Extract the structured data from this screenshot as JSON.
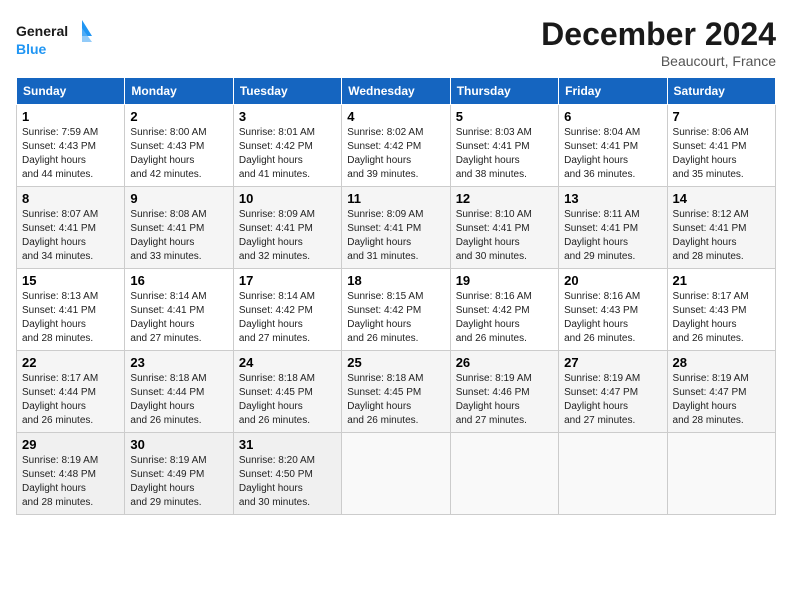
{
  "header": {
    "logo_line1": "General",
    "logo_line2": "Blue",
    "month": "December 2024",
    "location": "Beaucourt, France"
  },
  "weekdays": [
    "Sunday",
    "Monday",
    "Tuesday",
    "Wednesday",
    "Thursday",
    "Friday",
    "Saturday"
  ],
  "weeks": [
    [
      {
        "day": "1",
        "rise": "7:59 AM",
        "set": "4:43 PM",
        "daylight": "8 hours and 44 minutes."
      },
      {
        "day": "2",
        "rise": "8:00 AM",
        "set": "4:43 PM",
        "daylight": "8 hours and 42 minutes."
      },
      {
        "day": "3",
        "rise": "8:01 AM",
        "set": "4:42 PM",
        "daylight": "8 hours and 41 minutes."
      },
      {
        "day": "4",
        "rise": "8:02 AM",
        "set": "4:42 PM",
        "daylight": "8 hours and 39 minutes."
      },
      {
        "day": "5",
        "rise": "8:03 AM",
        "set": "4:41 PM",
        "daylight": "8 hours and 38 minutes."
      },
      {
        "day": "6",
        "rise": "8:04 AM",
        "set": "4:41 PM",
        "daylight": "8 hours and 36 minutes."
      },
      {
        "day": "7",
        "rise": "8:06 AM",
        "set": "4:41 PM",
        "daylight": "8 hours and 35 minutes."
      }
    ],
    [
      {
        "day": "8",
        "rise": "8:07 AM",
        "set": "4:41 PM",
        "daylight": "8 hours and 34 minutes."
      },
      {
        "day": "9",
        "rise": "8:08 AM",
        "set": "4:41 PM",
        "daylight": "8 hours and 33 minutes."
      },
      {
        "day": "10",
        "rise": "8:09 AM",
        "set": "4:41 PM",
        "daylight": "8 hours and 32 minutes."
      },
      {
        "day": "11",
        "rise": "8:09 AM",
        "set": "4:41 PM",
        "daylight": "8 hours and 31 minutes."
      },
      {
        "day": "12",
        "rise": "8:10 AM",
        "set": "4:41 PM",
        "daylight": "8 hours and 30 minutes."
      },
      {
        "day": "13",
        "rise": "8:11 AM",
        "set": "4:41 PM",
        "daylight": "8 hours and 29 minutes."
      },
      {
        "day": "14",
        "rise": "8:12 AM",
        "set": "4:41 PM",
        "daylight": "8 hours and 28 minutes."
      }
    ],
    [
      {
        "day": "15",
        "rise": "8:13 AM",
        "set": "4:41 PM",
        "daylight": "8 hours and 28 minutes."
      },
      {
        "day": "16",
        "rise": "8:14 AM",
        "set": "4:41 PM",
        "daylight": "8 hours and 27 minutes."
      },
      {
        "day": "17",
        "rise": "8:14 AM",
        "set": "4:42 PM",
        "daylight": "8 hours and 27 minutes."
      },
      {
        "day": "18",
        "rise": "8:15 AM",
        "set": "4:42 PM",
        "daylight": "8 hours and 26 minutes."
      },
      {
        "day": "19",
        "rise": "8:16 AM",
        "set": "4:42 PM",
        "daylight": "8 hours and 26 minutes."
      },
      {
        "day": "20",
        "rise": "8:16 AM",
        "set": "4:43 PM",
        "daylight": "8 hours and 26 minutes."
      },
      {
        "day": "21",
        "rise": "8:17 AM",
        "set": "4:43 PM",
        "daylight": "8 hours and 26 minutes."
      }
    ],
    [
      {
        "day": "22",
        "rise": "8:17 AM",
        "set": "4:44 PM",
        "daylight": "8 hours and 26 minutes."
      },
      {
        "day": "23",
        "rise": "8:18 AM",
        "set": "4:44 PM",
        "daylight": "8 hours and 26 minutes."
      },
      {
        "day": "24",
        "rise": "8:18 AM",
        "set": "4:45 PM",
        "daylight": "8 hours and 26 minutes."
      },
      {
        "day": "25",
        "rise": "8:18 AM",
        "set": "4:45 PM",
        "daylight": "8 hours and 26 minutes."
      },
      {
        "day": "26",
        "rise": "8:19 AM",
        "set": "4:46 PM",
        "daylight": "8 hours and 27 minutes."
      },
      {
        "day": "27",
        "rise": "8:19 AM",
        "set": "4:47 PM",
        "daylight": "8 hours and 27 minutes."
      },
      {
        "day": "28",
        "rise": "8:19 AM",
        "set": "4:47 PM",
        "daylight": "8 hours and 28 minutes."
      }
    ],
    [
      {
        "day": "29",
        "rise": "8:19 AM",
        "set": "4:48 PM",
        "daylight": "8 hours and 28 minutes."
      },
      {
        "day": "30",
        "rise": "8:19 AM",
        "set": "4:49 PM",
        "daylight": "8 hours and 29 minutes."
      },
      {
        "day": "31",
        "rise": "8:20 AM",
        "set": "4:50 PM",
        "daylight": "8 hours and 30 minutes."
      },
      null,
      null,
      null,
      null
    ]
  ]
}
